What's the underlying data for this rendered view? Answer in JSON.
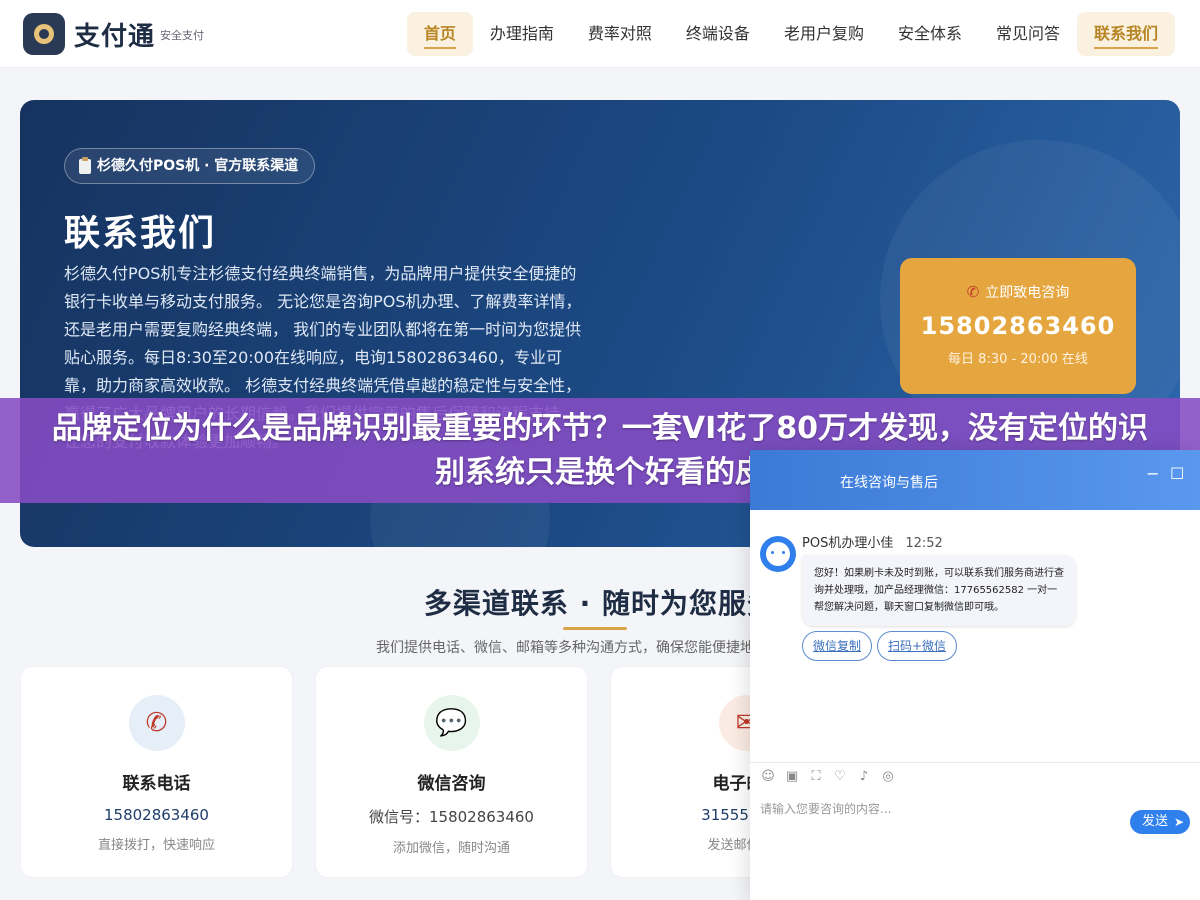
{
  "header": {
    "brand": "支付通",
    "tagline": "安全支付",
    "nav": [
      {
        "label": "首页",
        "active": true
      },
      {
        "label": "办理指南",
        "active": false
      },
      {
        "label": "费率对照",
        "active": false
      },
      {
        "label": "终端设备",
        "active": false
      },
      {
        "label": "老用户复购",
        "active": false
      },
      {
        "label": "安全体系",
        "active": false
      },
      {
        "label": "常见问答",
        "active": false
      },
      {
        "label": "联系我们",
        "active": true
      }
    ]
  },
  "hero": {
    "badge": "杉德久付POS机 · 官方联系渠道",
    "title": "联系我们",
    "description": "杉德久付POS机专注杉德支付经典终端销售，为品牌用户提供安全便捷的银行卡收单与移动支付服务。 无论您是咨询POS机办理、了解费率详情，还是老用户需要复购经典终端， 我们的专业团队都将在第一时间为您提供贴心服务。每日8:30至20:00在线响应，电询15802863460，专业可靠，助力商家高效收款。 杉德支付经典终端凭借卓越的稳定性与安全性，赢得了广大品牌用户的长期信赖。我们提供完善的售后保障和流程支持， 让您的支付收款体验更加顺畅。",
    "call": {
      "label": "立即致电咨询",
      "number": "15802863460",
      "hours": "每日 8:30 - 20:00 在线"
    }
  },
  "banner": {
    "text": "品牌定位为什么是品牌识别最重要的环节？一套VI花了80万才发现，没有定位的识别系统只是换个好看的皮"
  },
  "section": {
    "title": "多渠道联系 · 随时为您服务",
    "subtitle": "我们提供电话、微信、邮箱等多种沟通方式，确保您能便捷地联系到我们",
    "cards": [
      {
        "title": "联系电话",
        "value": "15802863460",
        "note": "直接拨打，快速响应"
      },
      {
        "title": "微信咨询",
        "value": "微信号：15802863460",
        "note": "添加微信，随时沟通"
      },
      {
        "title": "电子邮箱",
        "value": "31555555 3",
        "note": "发送邮件，详"
      }
    ]
  },
  "chat": {
    "title": "在线咨询与售后",
    "agent_name": "POS机办理小佳",
    "time": "12:52",
    "message": "您好！如果刷卡未及时到账，可以联系我们服务商进行查询并处理哦，加产品经理微信：17765562582 一对一帮您解决问题，聊天窗口复制微信即可哦。",
    "buttons": [
      "微信复制",
      "扫码+微信"
    ],
    "input_placeholder": "请输入您要咨询的内容...",
    "send_label": "发送"
  },
  "colors": {
    "accent": "#e6a63f",
    "hero_blue": "#1c4a85",
    "banner_purple": "#864cc4",
    "chat_blue": "#2f80ed"
  }
}
